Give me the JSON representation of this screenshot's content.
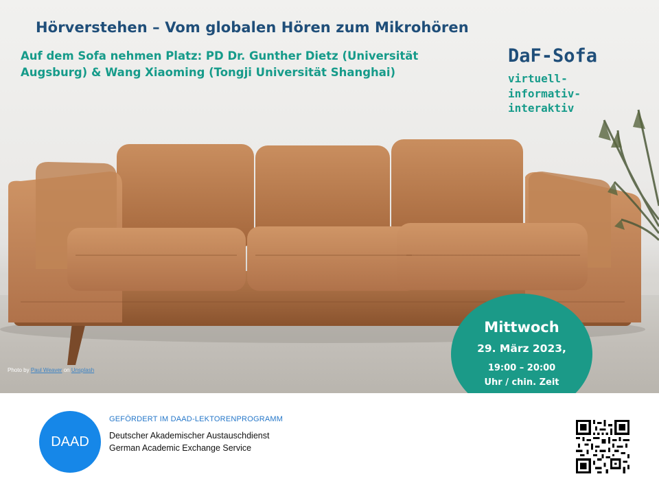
{
  "header": {
    "title": "Hörverstehen – Vom globalen Hören zum Mikrohören",
    "subtitle": "Auf dem Sofa nehmen Platz: PD Dr. Gunther Dietz (Universität Augsburg) & Wang Xiaoming (Tongji Universität Shanghai)"
  },
  "brand": {
    "name": "DaF-Sofa",
    "tagline": [
      "virtuell-",
      "informativ-",
      "interaktiv"
    ]
  },
  "photo_credit": {
    "prefix": "Photo by ",
    "author": "Paul Weaver",
    "middle": " on ",
    "source": "Unsplash"
  },
  "event": {
    "day": "Mittwoch",
    "date": "29. März 2023,",
    "time_line1": "19:00 – 20:00",
    "time_line2": "Uhr / chin. Zeit",
    "color": "#1b9a88"
  },
  "footer": {
    "logo_text": "DAAD",
    "funding": "GEFÖRDERT IM DAAD-LEKTORENPROGRAMM",
    "org_de": "Deutscher Akademischer Austauschdienst",
    "org_en": "German Academic Exchange Service",
    "logo_color": "#1687e8"
  },
  "colors": {
    "title": "#1f4e79",
    "accent": "#169b8a"
  },
  "icons": [
    "sofa-photo",
    "plant-photo",
    "qr-code-icon"
  ]
}
